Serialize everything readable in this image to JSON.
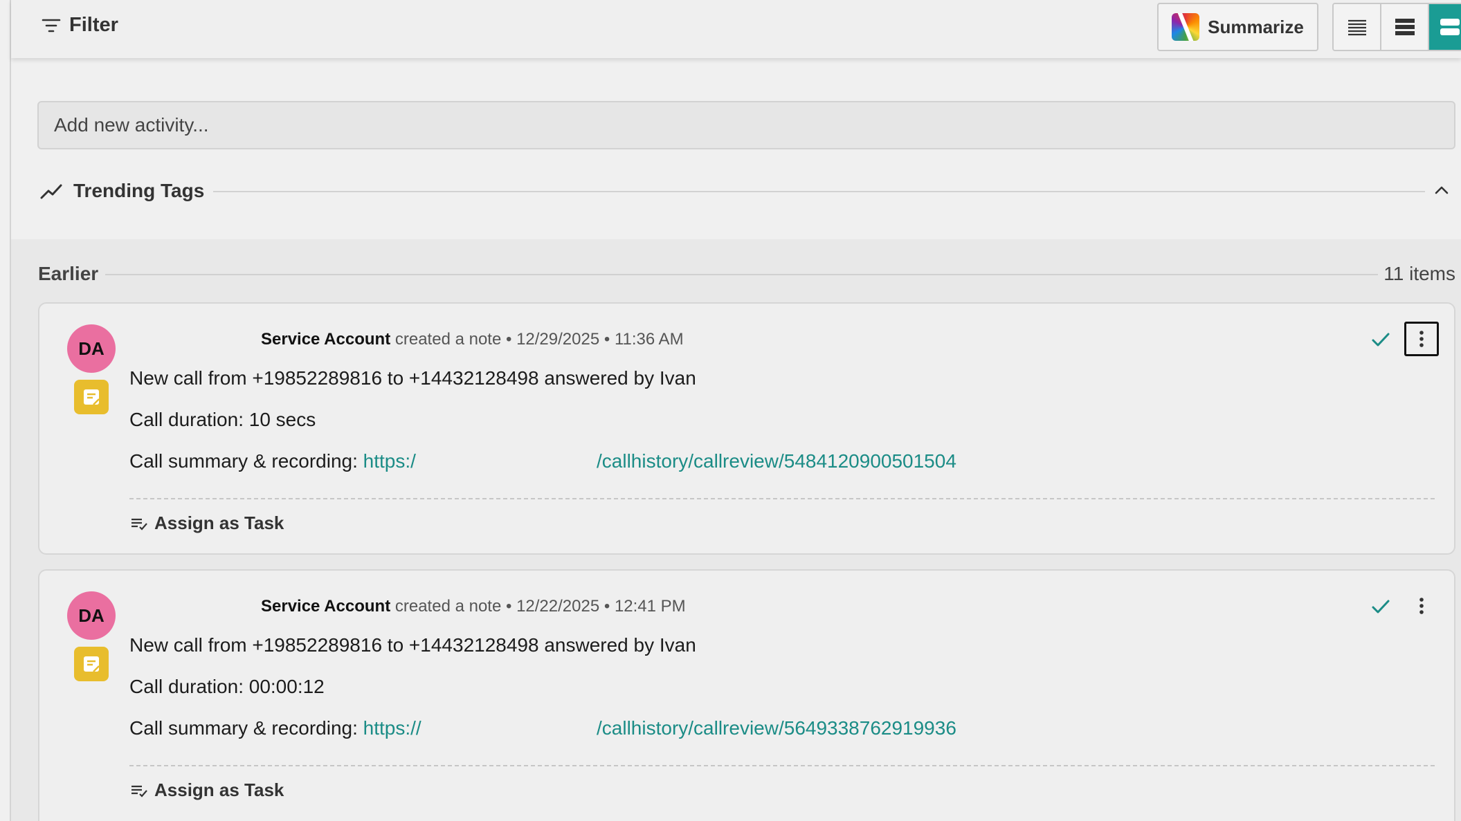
{
  "toolbar": {
    "filter_label": "Filter",
    "summarize_label": "Summarize"
  },
  "activity": {
    "placeholder": "Add new activity..."
  },
  "trending": {
    "title": "Trending Tags"
  },
  "section": {
    "title": "Earlier",
    "count": "11 items"
  },
  "colors": {
    "accent": "#1a9c94",
    "link": "#1b8c86",
    "avatar": "#ea6fa0",
    "note_badge": "#e8bd2d"
  },
  "notes": [
    {
      "avatar": "DA",
      "author": "Service Account",
      "action": "created a note",
      "date": "12/29/2025",
      "time": "11:36 AM",
      "line1": "New call from +19852289816 to +14432128498 answered by Ivan",
      "line2": "Call duration: 10 secs",
      "line3_label": "Call summary & recording: ",
      "link_a": "https:/",
      "link_b": "/callhistory/callreview/5484120900501504",
      "assign": "Assign as Task"
    },
    {
      "avatar": "DA",
      "author": "Service Account",
      "action": "created a note",
      "date": "12/22/2025",
      "time": "12:41 PM",
      "line1": "New call from +19852289816 to +14432128498 answered by Ivan",
      "line2": "Call duration: 00:00:12",
      "line3_label": "Call summary & recording: ",
      "link_a": "https://",
      "link_b": "/callhistory/callreview/5649338762919936",
      "assign": "Assign as Task"
    }
  ]
}
